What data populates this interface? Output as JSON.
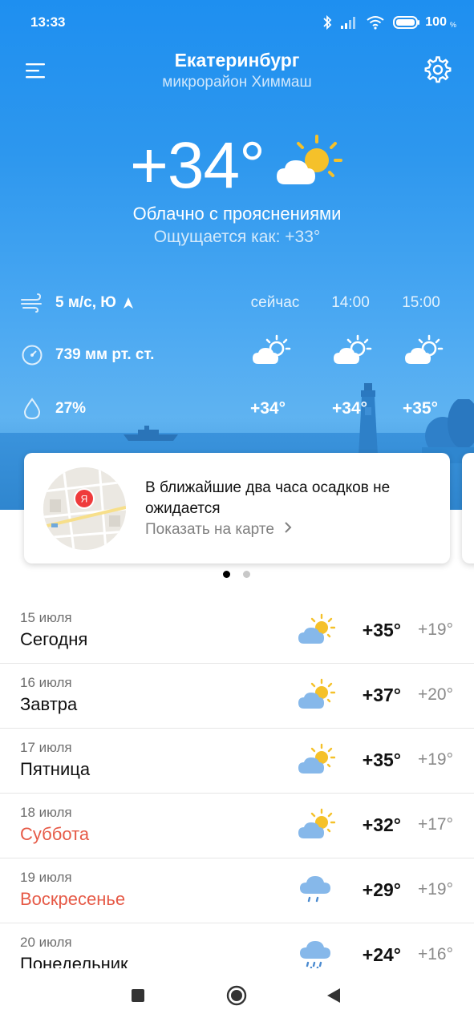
{
  "status_bar": {
    "time": "13:33",
    "battery": "100",
    "battery_unit": "%",
    "icons": [
      "bluetooth-icon",
      "signal-icon",
      "wifi-icon",
      "battery-icon"
    ]
  },
  "header": {
    "city": "Екатеринбург",
    "district": "микрорайон Химмаш",
    "menu_icon": "hamburger-menu-icon",
    "settings_icon": "gear-icon"
  },
  "current": {
    "temperature": "+34°",
    "condition": "Облачно с прояснениями",
    "feels_like": "Ощущается как: +33°",
    "icon": "partly-cloudy-icon",
    "wind": "5 м/с, Ю",
    "pressure": "739 мм рт. ст.",
    "humidity": "27%"
  },
  "hourly": [
    {
      "label": "сейчас",
      "temp": "+34°",
      "icon": "partly-cloudy-icon"
    },
    {
      "label": "14:00",
      "temp": "+34°",
      "icon": "partly-cloudy-icon"
    },
    {
      "label": "15:00",
      "temp": "+35°",
      "icon": "partly-cloudy-icon"
    }
  ],
  "precip_card": {
    "message": "В ближайшие два часа осадков не ожидается",
    "link": "Показать на карте",
    "map_pin": "Я"
  },
  "daily": [
    {
      "date": "15 июля",
      "day": "Сегодня",
      "max": "+35°",
      "min": "+19°",
      "icon": "partly-cloudy-icon",
      "weekend": false
    },
    {
      "date": "16 июля",
      "day": "Завтра",
      "max": "+37°",
      "min": "+20°",
      "icon": "partly-cloudy-icon",
      "weekend": false
    },
    {
      "date": "17 июля",
      "day": "Пятница",
      "max": "+35°",
      "min": "+19°",
      "icon": "partly-cloudy-icon",
      "weekend": false
    },
    {
      "date": "18 июля",
      "day": "Суббота",
      "max": "+32°",
      "min": "+17°",
      "icon": "partly-cloudy-icon",
      "weekend": true
    },
    {
      "date": "19 июля",
      "day": "Воскресенье",
      "max": "+29°",
      "min": "+19°",
      "icon": "light-rain-icon",
      "weekend": true
    },
    {
      "date": "20 июля",
      "day": "Понедельник",
      "max": "+24°",
      "min": "+16°",
      "icon": "rain-icon",
      "weekend": false
    }
  ],
  "colors": {
    "sky": "#2d97ee",
    "weekend_text": "#e65a47",
    "sun": "#f5c12a",
    "cloud_day": "#86b8ea"
  },
  "navbar": {
    "icons": [
      "nav-recents-icon",
      "nav-home-icon",
      "nav-back-icon"
    ]
  }
}
